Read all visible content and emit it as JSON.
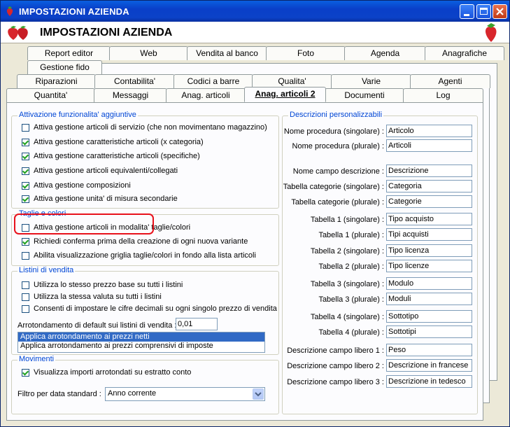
{
  "window": {
    "title": "IMPOSTAZIONI AZIENDA"
  },
  "header": {
    "title": "IMPOSTAZIONI AZIENDA"
  },
  "tabs": {
    "row1": [
      "Report editor",
      "Web",
      "Vendita al banco",
      "Foto",
      "Agenda",
      "Anagrafiche"
    ],
    "row2": [
      "Gestione fido"
    ],
    "row3": [
      "Riparazioni",
      "Contabilita'",
      "Codici a barre",
      "Qualita'",
      "Varie",
      "Agenti"
    ],
    "row4": [
      "Quantita'",
      "Messaggi",
      "Anag. articoli",
      "Anag. articoli 2",
      "Documenti",
      "Log"
    ]
  },
  "attivazione": {
    "title": "Attivazione funzionalita' aggiuntive",
    "items": [
      {
        "label": "Attiva gestione articoli di servizio (che non movimentano magazzino)",
        "checked": false
      },
      {
        "label": "Attiva gestione caratteristiche articoli (x categoria)",
        "checked": true
      },
      {
        "label": "Attiva gestione caratteristiche articoli (specifiche)",
        "checked": true
      },
      {
        "label": "Attiva gestione articoli equivalenti/collegati",
        "checked": true
      },
      {
        "label": "Attiva gestione composizioni",
        "checked": true
      },
      {
        "label": "Attiva gestione unita' di misura secondarie",
        "checked": true
      }
    ]
  },
  "taglie": {
    "title": "Taglie e colori",
    "items": [
      {
        "label": "Attiva gestione articoli in modalita' taglie/colori",
        "checked": false
      },
      {
        "label": "Richiedi conferma prima della creazione di ogni nuova variante",
        "checked": true
      },
      {
        "label": "Abilita visualizzazione griglia taglie/colori in fondo alla lista articoli",
        "checked": false
      }
    ]
  },
  "listini": {
    "title": "Listini di vendita",
    "items": [
      {
        "label": "Utilizza lo stesso prezzo base su tutti i listini",
        "checked": false
      },
      {
        "label": "Utilizza la stessa valuta su tutti i listini",
        "checked": false
      },
      {
        "label": "Consenti di impostare le cifre decimali su ogni singolo prezzo di vendita",
        "checked": false
      }
    ],
    "arrotondamento_label": "Arrotondamento di default sui listini di vendita :",
    "arrotondamento_value": "0,01",
    "options": [
      "Applica arrotondamento ai prezzi netti",
      "Applica arrotondamento ai prezzi comprensivi di imposte"
    ]
  },
  "movimenti": {
    "title": "Movimenti",
    "item": {
      "label": "Visualizza importi arrotondati su estratto conto",
      "checked": true
    },
    "filtro_label": "Filtro per data standard :",
    "filtro_value": "Anno corrente"
  },
  "descrizioni": {
    "title": "Descrizioni personalizzabili",
    "rows": [
      {
        "label": "Nome procedura (singolare) :",
        "value": "Articolo"
      },
      {
        "label": "Nome procedura (plurale) :",
        "value": "Articoli"
      },
      {
        "label": "Nome campo descrizione :",
        "value": "Descrizione"
      },
      {
        "label": "Tabella categorie (singolare) :",
        "value": "Categoria"
      },
      {
        "label": "Tabella categorie (plurale) :",
        "value": "Categorie"
      },
      {
        "label": "Tabella 1 (singolare) :",
        "value": "Tipo acquisto"
      },
      {
        "label": "Tabella 1 (plurale) :",
        "value": "Tipi acquisti"
      },
      {
        "label": "Tabella 2 (singolare) :",
        "value": "Tipo licenza"
      },
      {
        "label": "Tabella 2 (plurale) :",
        "value": "Tipo licenze"
      },
      {
        "label": "Tabella 3 (singolare) :",
        "value": "Modulo"
      },
      {
        "label": "Tabella 3 (plurale) :",
        "value": "Moduli"
      },
      {
        "label": "Tabella 4 (singolare) :",
        "value": "Sottotipo"
      },
      {
        "label": "Tabella 4 (plurale) :",
        "value": "Sottotipi"
      },
      {
        "label": "Descrizione campo libero 1 :",
        "value": "Peso"
      },
      {
        "label": "Descrizione campo libero 2 :",
        "value": "Descrizione in francese"
      },
      {
        "label": "Descrizione campo libero 3 :",
        "value": "Descrizione in tedesco"
      }
    ]
  },
  "colors": {
    "titlebar": "#0a46d0",
    "accent": "#0046d5",
    "selection": "#316ac5",
    "highlight": "#e8111b"
  },
  "icons": [
    "strawberry-icon",
    "minimize-icon",
    "maximize-icon",
    "close-icon",
    "chevron-down-icon"
  ]
}
